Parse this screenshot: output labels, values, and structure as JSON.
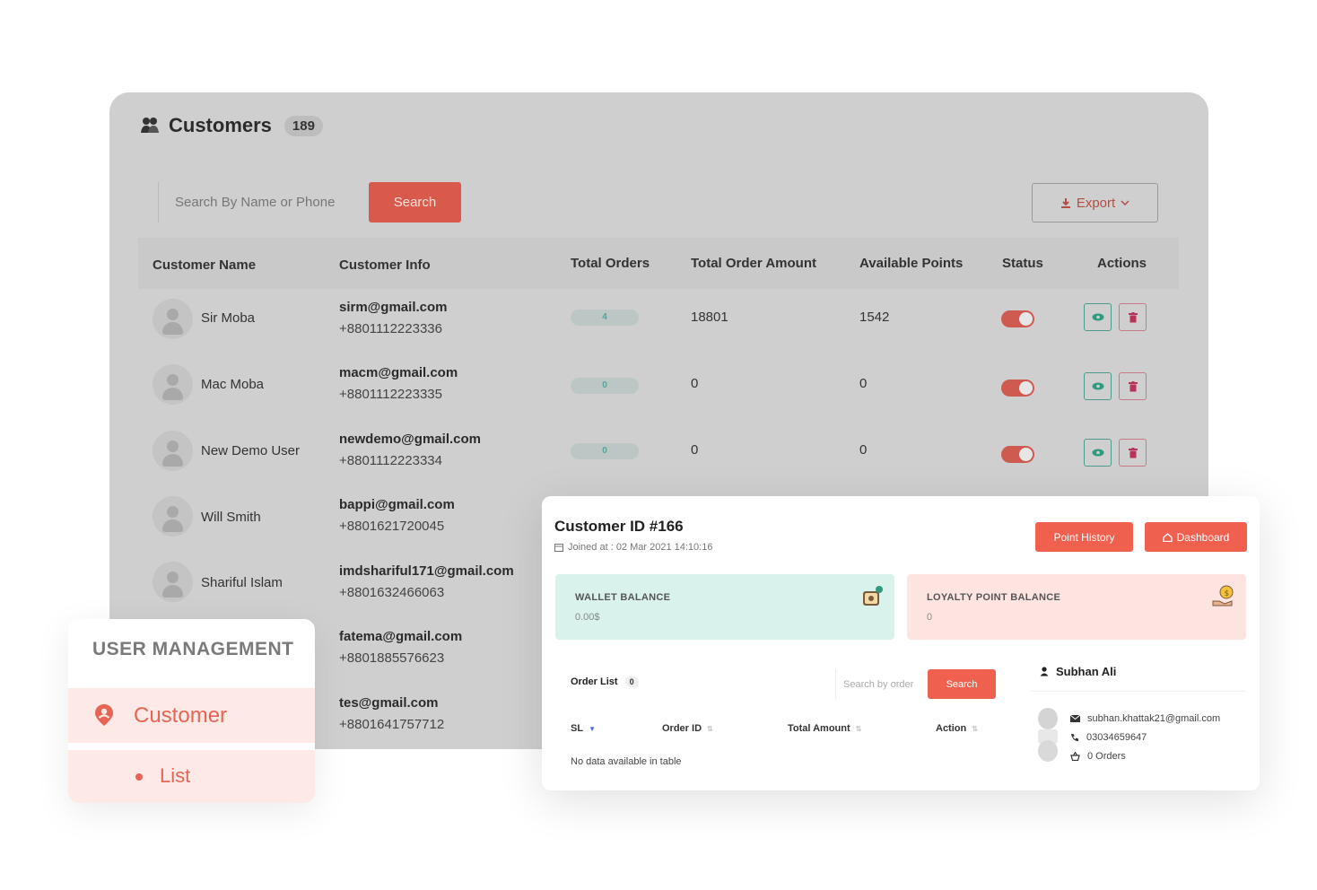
{
  "customers": {
    "title": "Customers",
    "count": "189",
    "search_placeholder": "Search By Name or Phone",
    "search_label": "Search",
    "export_label": "Export",
    "columns": [
      "Customer Name",
      "Customer Info",
      "Total Orders",
      "Total Order Amount",
      "Available Points",
      "Status",
      "Actions"
    ],
    "rows": [
      {
        "name": "Sir Moba",
        "email": "sirm@gmail.com",
        "phone": "+8801112223336",
        "orders": "4",
        "amount": "18801",
        "points": "1542"
      },
      {
        "name": "Mac Moba",
        "email": "macm@gmail.com",
        "phone": "+8801112223335",
        "orders": "0",
        "amount": "0",
        "points": "0"
      },
      {
        "name": "New Demo User",
        "email": "newdemo@gmail.com",
        "phone": "+8801112223334",
        "orders": "0",
        "amount": "0",
        "points": "0"
      },
      {
        "name": "Will Smith",
        "email": "bappi@gmail.com",
        "phone": "+8801621720045"
      },
      {
        "name": "Shariful Islam",
        "email": "imdshariful171@gmail.com",
        "phone": "+8801632466063"
      },
      {
        "email": "fatema@gmail.com",
        "phone": "+8801885576623"
      },
      {
        "email": "tes@gmail.com",
        "phone": "+8801641757712"
      }
    ]
  },
  "user_management": {
    "title": "USER MANAGEMENT",
    "item": "Customer",
    "sub_item": "List"
  },
  "detail": {
    "title": "Customer ID #166",
    "joined": "Joined at : 02 Mar 2021 14:10:16",
    "point_history_label": "Point History",
    "dashboard_label": "Dashboard",
    "wallet_label": "WALLET BALANCE",
    "wallet_value": "0.00$",
    "loyalty_label": "LOYALTY POINT BALANCE",
    "loyalty_value": "0",
    "order_list_label": "Order List",
    "order_list_count": "0",
    "order_search_placeholder": "Search by order",
    "order_search_label": "Search",
    "order_columns": [
      "SL",
      "Order ID",
      "Total Amount",
      "Action"
    ],
    "no_data": "No data available in table",
    "customer_name": "Subhan Ali",
    "customer_email": "subhan.khattak21@gmail.com",
    "customer_phone": "03034659647",
    "customer_orders": "0 Orders"
  },
  "colors": {
    "accent": "#f0604f",
    "wallet_bg": "#d9f2ec",
    "loyalty_bg": "#fde4e1",
    "menu_active": "#e76455"
  }
}
